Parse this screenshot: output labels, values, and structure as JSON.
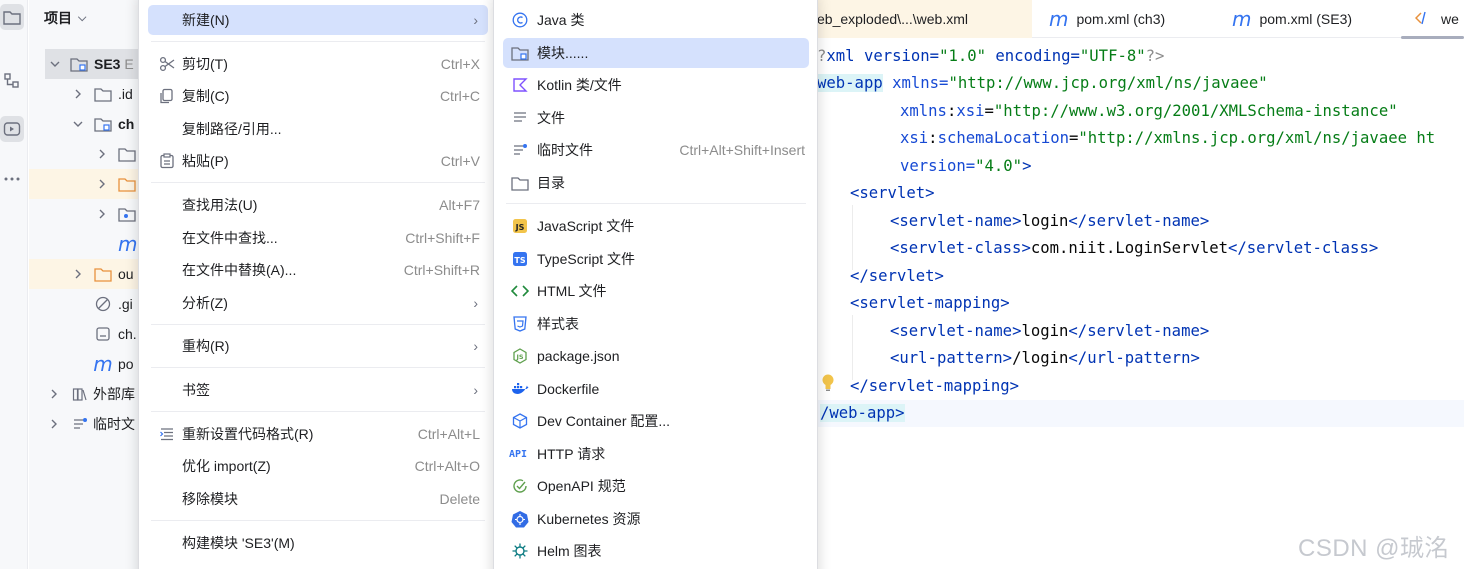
{
  "project_pane": {
    "title": "项目",
    "tree": [
      {
        "name": "SE3",
        "suffix": "E"
      },
      {
        "name": ".id"
      },
      {
        "name": "ch"
      },
      {
        "name": ""
      },
      {
        "name": ""
      },
      {
        "name": ""
      },
      {
        "name": "m"
      },
      {
        "name": "ou"
      },
      {
        "name": ".gi"
      },
      {
        "name": "ch."
      },
      {
        "name": "po"
      },
      {
        "name": "外部库"
      },
      {
        "name": "临时文"
      }
    ]
  },
  "editor": {
    "tabs": [
      {
        "label": "eb_exploded\\...\\web.xml"
      },
      {
        "label": "pom.xml (ch3)"
      },
      {
        "label": "pom.xml (SE3)"
      },
      {
        "label": "we"
      }
    ],
    "code": [
      {
        "pre": "?",
        "t1": "xml version=",
        "v1": "\"1.0\"",
        "t2": " encoding=",
        "v2": "\"UTF-8\"",
        "post": "?>"
      },
      {
        "tag": "web-app",
        "attr": " xmlns=",
        "val": "\"http://www.jcp.org/xml/ns/javaee\""
      },
      {
        "attr_ns": "xmlns",
        "attr_colon": ":",
        "attr_name": "xsi",
        "eq": "=",
        "val": "\"http://www.w3.org/2001/XMLSchema-instance\""
      },
      {
        "attr_ns": "xsi",
        "attr_colon": ":",
        "attr_name": "schemaLocation",
        "eq": "=",
        "val": "\"http://xmlns.jcp.org/xml/ns/javaee ht"
      },
      {
        "attr": "version=",
        "val": "\"4.0\"",
        "post": ">"
      },
      {
        "open": "<",
        "tag": "servlet",
        "close": ">"
      },
      {
        "open": "<",
        "tag": "servlet-name",
        "close": ">",
        "text": "login",
        "eopen": "</",
        "etag": "servlet-name",
        "eclose": ">"
      },
      {
        "open": "<",
        "tag": "servlet-class",
        "close": ">",
        "text": "com.niit.LoginServlet",
        "eopen": "</",
        "etag": "servlet-class",
        "eclose": ">"
      },
      {
        "open": "</",
        "tag": "servlet",
        "close": ">"
      },
      {
        "open": "<",
        "tag": "servlet-mapping",
        "close": ">"
      },
      {
        "open": "<",
        "tag": "servlet-name",
        "close": ">",
        "text": "login",
        "eopen": "</",
        "etag": "servlet-name",
        "eclose": ">"
      },
      {
        "open": "<",
        "tag": "url-pattern",
        "close": ">",
        "text": "/login",
        "eopen": "</",
        "etag": "url-pattern",
        "eclose": ">"
      },
      {
        "open": "</",
        "tag": "servlet-mapping",
        "close": ">"
      },
      {
        "open": "/",
        "tag": "web-app",
        "close": ">"
      }
    ]
  },
  "context_menu": {
    "items": [
      {
        "label": "新建(N)",
        "shortcut": "",
        "submenu": true
      },
      {
        "label": "剪切(T)",
        "shortcut": "Ctrl+X"
      },
      {
        "label": "复制(C)",
        "shortcut": "Ctrl+C"
      },
      {
        "label": "复制路径/引用...",
        "shortcut": ""
      },
      {
        "label": "粘贴(P)",
        "shortcut": "Ctrl+V"
      },
      {
        "label": "查找用法(U)",
        "shortcut": "Alt+F7"
      },
      {
        "label": "在文件中查找...",
        "shortcut": "Ctrl+Shift+F"
      },
      {
        "label": "在文件中替换(A)...",
        "shortcut": "Ctrl+Shift+R"
      },
      {
        "label": "分析(Z)",
        "shortcut": "",
        "submenu": true
      },
      {
        "label": "重构(R)",
        "shortcut": "",
        "submenu": true
      },
      {
        "label": "书签",
        "shortcut": "",
        "submenu": true
      },
      {
        "label": "重新设置代码格式(R)",
        "shortcut": "Ctrl+Alt+L"
      },
      {
        "label": "优化 import(Z)",
        "shortcut": "Ctrl+Alt+O"
      },
      {
        "label": "移除模块",
        "shortcut": "Delete"
      },
      {
        "label": "构建模块 'SE3'(M)",
        "shortcut": ""
      }
    ]
  },
  "new_submenu": {
    "items": [
      {
        "label": "Java 类",
        "shortcut": "",
        "icon": "java-class-icon"
      },
      {
        "label": "模块......",
        "shortcut": "",
        "icon": "module-icon"
      },
      {
        "label": "Kotlin 类/文件",
        "shortcut": "",
        "icon": "kotlin-icon"
      },
      {
        "label": "文件",
        "shortcut": "",
        "icon": "file-icon"
      },
      {
        "label": "临时文件",
        "shortcut": "Ctrl+Alt+Shift+Insert",
        "icon": "scratch-file-icon"
      },
      {
        "label": "目录",
        "shortcut": "",
        "icon": "folder-icon"
      },
      {
        "label": "JavaScript 文件",
        "shortcut": "",
        "icon": "javascript-icon"
      },
      {
        "label": "TypeScript 文件",
        "shortcut": "",
        "icon": "typescript-icon"
      },
      {
        "label": "HTML 文件",
        "shortcut": "",
        "icon": "html-icon"
      },
      {
        "label": "样式表",
        "shortcut": "",
        "icon": "css-icon"
      },
      {
        "label": "package.json",
        "shortcut": "",
        "icon": "nodejs-icon"
      },
      {
        "label": "Dockerfile",
        "shortcut": "",
        "icon": "docker-icon"
      },
      {
        "label": "Dev Container 配置...",
        "shortcut": "",
        "icon": "dev-container-icon"
      },
      {
        "label": "HTTP 请求",
        "shortcut": "",
        "icon": "api-icon"
      },
      {
        "label": "OpenAPI 规范",
        "shortcut": "",
        "icon": "openapi-icon"
      },
      {
        "label": "Kubernetes 资源",
        "shortcut": "",
        "icon": "kubernetes-icon"
      },
      {
        "label": "Helm 图表",
        "shortcut": "",
        "icon": "helm-icon"
      }
    ]
  },
  "watermark": "CSDN @珹洺"
}
